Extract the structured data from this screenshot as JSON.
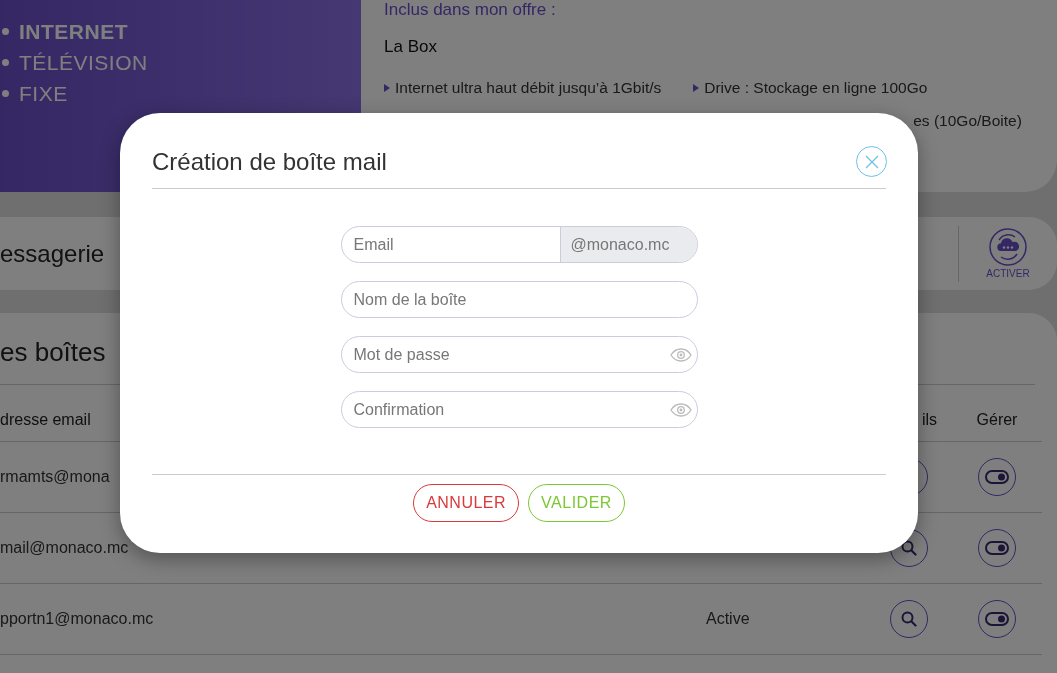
{
  "nav": {
    "items": [
      {
        "label": "INTERNET",
        "selected": true
      },
      {
        "label": "TÉLÉVISION",
        "selected": false
      },
      {
        "label": "FIXE",
        "selected": false
      }
    ]
  },
  "offer": {
    "heading": "Inclus dans mon offre :",
    "title": "La Box",
    "features_left": [
      "Internet ultra haut débit jusqu’à 1Gbit/s"
    ],
    "features_right": [
      {
        "text": "Drive : Stockage en ligne 100Go",
        "bullet": true
      },
      {
        "text": "es (10Go/Boite)",
        "bullet": false
      }
    ]
  },
  "messagerie": {
    "title": "essagerie",
    "action": "ACTIVER"
  },
  "mailboxes": {
    "title": "es boîtes",
    "header_email": "dresse email",
    "header_details": "ils",
    "header_manage": "Gérer",
    "rows": [
      {
        "email": "rmamts@mona"
      },
      {
        "email": "mail@monaco.mc"
      },
      {
        "email": "pportn1@monaco.mc",
        "status": "Active"
      }
    ]
  },
  "modal": {
    "title": "Création de boîte mail",
    "fields": [
      {
        "kind": "text",
        "placeholder": "Email",
        "suffix": "@monaco.mc"
      },
      {
        "kind": "text",
        "placeholder": "Nom de la boîte"
      },
      {
        "kind": "password",
        "placeholder": "Mot de passe"
      },
      {
        "kind": "password",
        "placeholder": "Confirmation"
      }
    ],
    "buttons": [
      {
        "kind": "cancel",
        "label": "ANNULER"
      },
      {
        "kind": "confirm",
        "label": "VALIDER"
      }
    ]
  }
}
